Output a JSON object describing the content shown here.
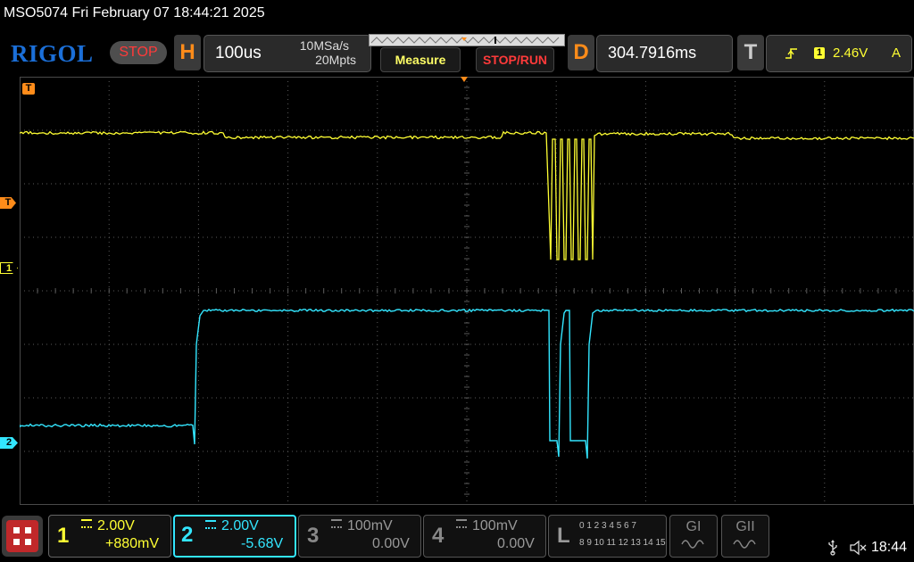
{
  "title": "MSO5074  Fri February 07 18:44:21 2025",
  "brand": "RIGOL",
  "run_state": "STOP",
  "horizontal": {
    "letter": "H",
    "timebase": "100us",
    "sample_rate": "10MSa/s",
    "memory_depth": "20Mpts"
  },
  "buttons": {
    "measure": "Measure",
    "stop_run": "STOP/RUN"
  },
  "delay": {
    "letter": "D",
    "value": "304.7916ms"
  },
  "trigger": {
    "letter": "T",
    "source": "1",
    "level": "2.46V",
    "mode": "A"
  },
  "markers": {
    "trigger_t": "T",
    "ch1": "1",
    "ch2": "2"
  },
  "channels": [
    {
      "num": "1",
      "scale": "2.00V",
      "offset": "+880mV",
      "color": "#ffff33",
      "active": true
    },
    {
      "num": "2",
      "scale": "2.00V",
      "offset": "-5.68V",
      "color": "#33e6ff",
      "active": true
    },
    {
      "num": "3",
      "scale": "100mV",
      "offset": "0.00V",
      "color": "#777777",
      "active": false
    },
    {
      "num": "4",
      "scale": "100mV",
      "offset": "0.00V",
      "color": "#777777",
      "active": false
    }
  ],
  "logic": {
    "letter": "L",
    "row1": "0 1 2 3  4 5 6 7",
    "row2": "8 9 10 11 12 13 14 15"
  },
  "generators": {
    "g1": "GI",
    "g2": "GII"
  },
  "clock": "18:44",
  "colors": {
    "ch1": "#ffff33",
    "ch2": "#33e6ff",
    "accent": "#ff8c1a",
    "grid": "#5a5a5a"
  }
}
